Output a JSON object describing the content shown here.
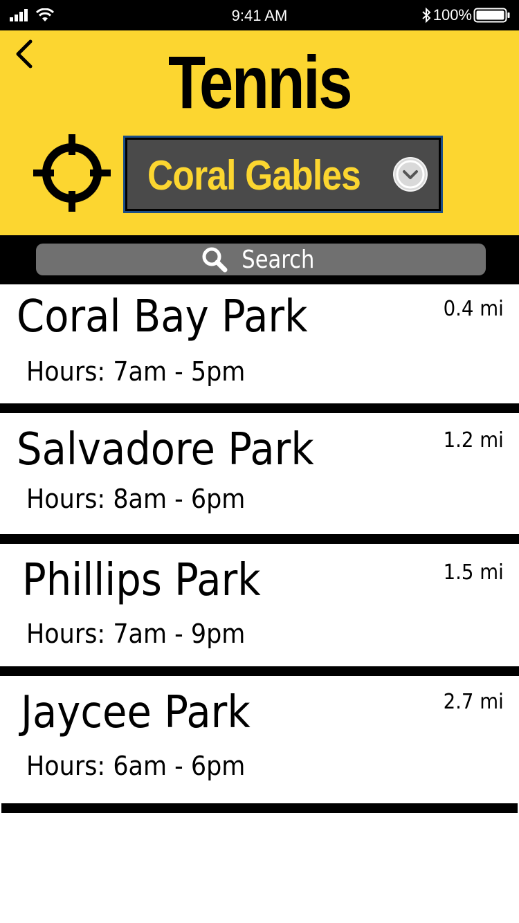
{
  "status_bar": {
    "time": "9:41 AM",
    "battery": "100%",
    "signal_icon": "signal-bars-icon",
    "wifi_icon": "wifi-icon",
    "bluetooth_icon": "bluetooth-icon",
    "battery_icon": "battery-icon"
  },
  "header": {
    "title": "Tennis",
    "back_icon": "chevron-left-icon",
    "locate_icon": "crosshair-icon",
    "location": {
      "selected": "Coral Gables",
      "icon": "chevron-down-circle-icon"
    },
    "background_color": "#fcd630"
  },
  "search": {
    "placeholder": "Search",
    "icon": "search-icon"
  },
  "parks": [
    {
      "name": "Coral Bay Park",
      "hours": "Hours: 7am - 5pm",
      "distance": "0.4 mi"
    },
    {
      "name": "Salvadore Park",
      "hours": "Hours: 8am - 6pm",
      "distance": "1.2 mi"
    },
    {
      "name": "Phillips Park",
      "hours": "Hours: 7am - 9pm",
      "distance": "1.5 mi"
    },
    {
      "name": "Jaycee Park",
      "hours": "Hours: 6am - 6pm",
      "distance": "2.7 mi"
    }
  ]
}
